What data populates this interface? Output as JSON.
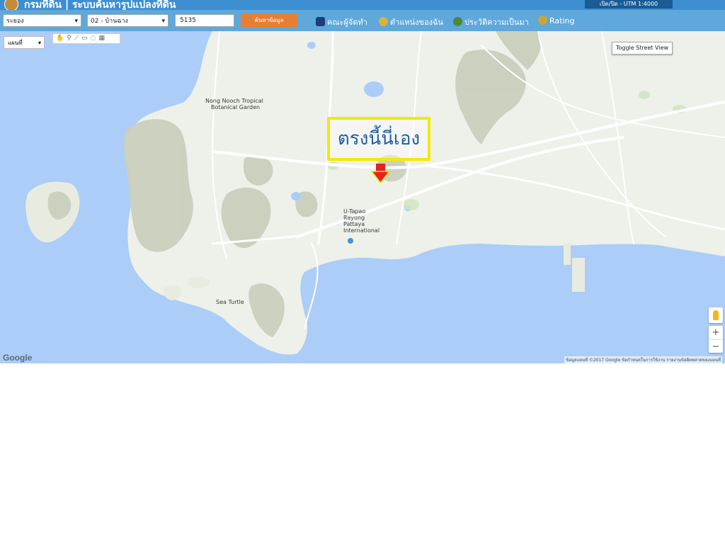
{
  "header": {
    "title": "กรมที่ดิน | ระบบค้นหารูปแปลงที่ดิน",
    "top_right_button": "เปิด/ปิด - UTM 1:4000"
  },
  "toolbar": {
    "province": "ระยอง",
    "district": "02 - บ้านฉาง",
    "parcel_number": "5135",
    "search_button": "ค้นหาข้อมูล",
    "nav": [
      {
        "label": "คณะผู้จัดทำ",
        "icon": "team-icon"
      },
      {
        "label": "ตำแหน่งของฉัน",
        "icon": "my-location-icon"
      },
      {
        "label": "ประวัติความเป็นมา",
        "icon": "history-icon"
      },
      {
        "label": "Rating",
        "icon": "rating-icon"
      }
    ]
  },
  "map_controls": {
    "map_type": "แผนที่",
    "street_view_toggle": "Toggle Street View",
    "zoom_in": "+",
    "zoom_out": "−",
    "google_logo": "Google",
    "attribution": "ข้อมูลแผนที่ ©2017 Google   ข้อกำหนดในการใช้งาน   รายงานข้อผิดพลาดของแผนที่"
  },
  "annotation": {
    "callout_text": "ตรงนี้นี่เอง"
  },
  "map_labels": {
    "nong_nooch": "Nong Nooch Tropical",
    "botanical_garden": "Botanical Garden",
    "utapao_1": "U-Tapao",
    "utapao_2": "Rayong",
    "utapao_3": "Pattaya",
    "utapao_4": "International",
    "sea_turtle": "Sea Turtle"
  },
  "colors": {
    "water": "#abcdf8",
    "land": "#eef0ea",
    "callout_border": "#f4e900",
    "callout_text": "#1f5fa8",
    "arrow": "#e52222"
  }
}
